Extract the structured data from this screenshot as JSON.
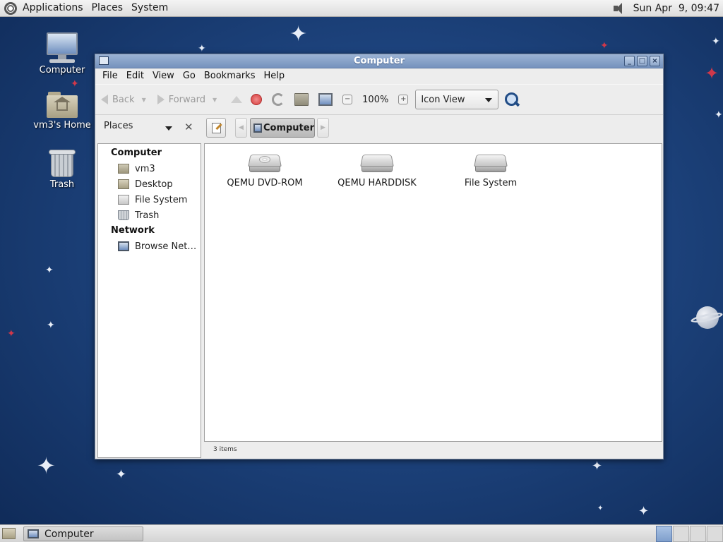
{
  "top_panel": {
    "menus": [
      "Applications",
      "Places",
      "System"
    ],
    "clock": "Sun Apr  9, 09:47"
  },
  "desktop_icons": [
    {
      "label": "Computer"
    },
    {
      "label": "vm3's Home"
    },
    {
      "label": "Trash"
    }
  ],
  "window": {
    "title": "Computer",
    "menubar": [
      "File",
      "Edit",
      "View",
      "Go",
      "Bookmarks",
      "Help"
    ],
    "toolbar": {
      "back_label": "Back",
      "forward_label": "Forward",
      "zoom_level": "100%",
      "view_mode": "Icon View"
    },
    "location": {
      "pane_selector": "Places",
      "current_crumb": "Computer"
    },
    "sidebar": {
      "sections": [
        {
          "header": "Computer",
          "items": [
            "vm3",
            "Desktop",
            "File System",
            "Trash"
          ]
        },
        {
          "header": "Network",
          "items": [
            "Browse Net…"
          ]
        }
      ]
    },
    "files": [
      {
        "name": "QEMU DVD-ROM",
        "kind": "optical-drive"
      },
      {
        "name": "QEMU HARDDISK",
        "kind": "hard-disk"
      },
      {
        "name": "File System",
        "kind": "hard-disk"
      }
    ],
    "status": "3 items"
  },
  "bottom_panel": {
    "task_label": "Computer",
    "workspace_count": 4,
    "active_workspace": 1
  },
  "colors": {
    "desktop_bg": "#1d437d",
    "titlebar": "#7592bd",
    "accent_star": "#d0384a"
  }
}
